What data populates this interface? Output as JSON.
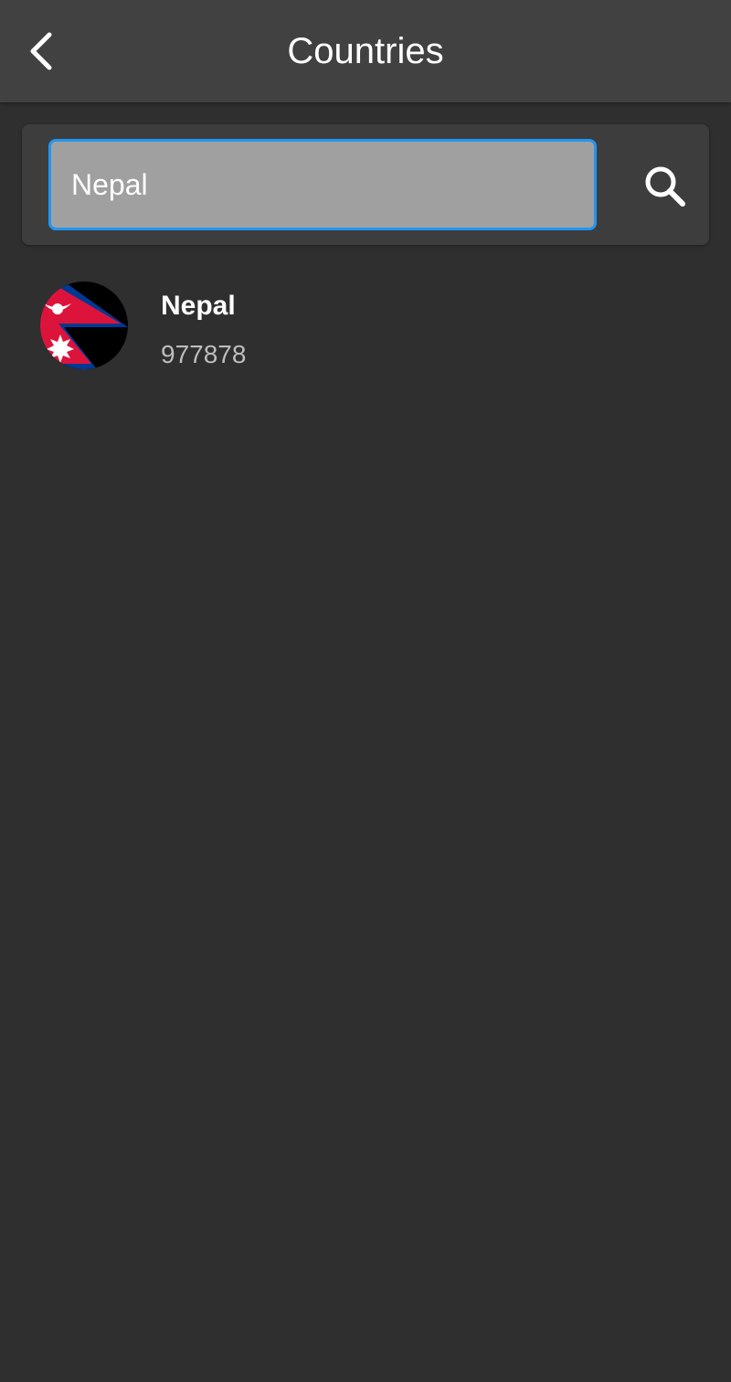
{
  "header": {
    "title": "Countries",
    "back_icon": "chevron-left-icon"
  },
  "search": {
    "value": "Nepal",
    "placeholder": "",
    "icon": "search-icon",
    "accent_color": "#2196f3"
  },
  "countries": [
    {
      "name": "Nepal",
      "code": "977878",
      "flag_icon": "nepal-flag-icon"
    }
  ],
  "colors": {
    "background": "#2f2f2f",
    "topbar": "#414141",
    "card": "#3d3d3d",
    "input_fill": "#a0a0a0",
    "flag_red": "#dc143c",
    "flag_blue": "#003893"
  }
}
